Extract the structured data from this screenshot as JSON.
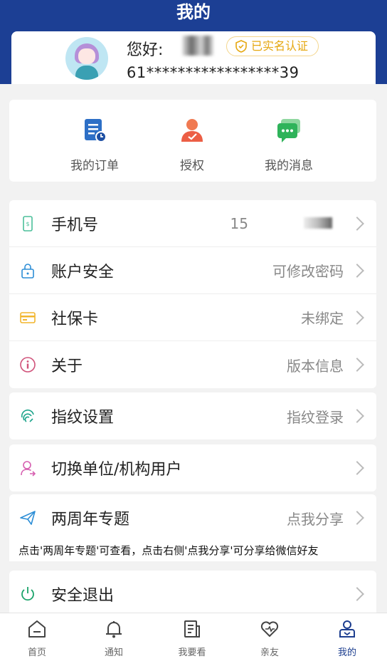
{
  "header": {
    "title": "我的"
  },
  "profile": {
    "greeting": "您好:",
    "verified_badge": "已实名认证",
    "masked_id": "61*****************39"
  },
  "quick_actions": [
    {
      "label": "我的订单",
      "icon": "order-icon"
    },
    {
      "label": "授权",
      "icon": "authorize-icon"
    },
    {
      "label": "我的消息",
      "icon": "message-icon"
    }
  ],
  "menu_group1": [
    {
      "label": "手机号",
      "value": "15",
      "icon": "phone-icon"
    },
    {
      "label": "账户安全",
      "value": "可修改密码",
      "icon": "lock-icon"
    },
    {
      "label": "社保卡",
      "value": "未绑定",
      "icon": "card-icon"
    },
    {
      "label": "关于",
      "value": "版本信息",
      "icon": "info-icon"
    }
  ],
  "fingerprint": {
    "label": "指纹设置",
    "value": "指纹登录",
    "icon": "fingerprint-icon"
  },
  "switch_user": {
    "label": "切换单位/机构用户",
    "value": "",
    "icon": "switch-user-icon"
  },
  "anniversary": {
    "label": "两周年专题",
    "value": "点我分享",
    "icon": "send-icon"
  },
  "note": "点击'两周年专题'可查看，点击右侧'点我分享'可分享给微信好友",
  "logout": {
    "label": "安全退出",
    "icon": "power-icon"
  },
  "tabs": [
    {
      "label": "首页",
      "icon": "home-icon"
    },
    {
      "label": "通知",
      "icon": "bell-icon"
    },
    {
      "label": "我要看",
      "icon": "document-icon"
    },
    {
      "label": "亲友",
      "icon": "heart-icon"
    },
    {
      "label": "我的",
      "icon": "user-icon",
      "active": true
    }
  ],
  "colors": {
    "primary": "#1c3f94",
    "badge": "#e5a70f",
    "active_tab": "#1d3e8f"
  }
}
